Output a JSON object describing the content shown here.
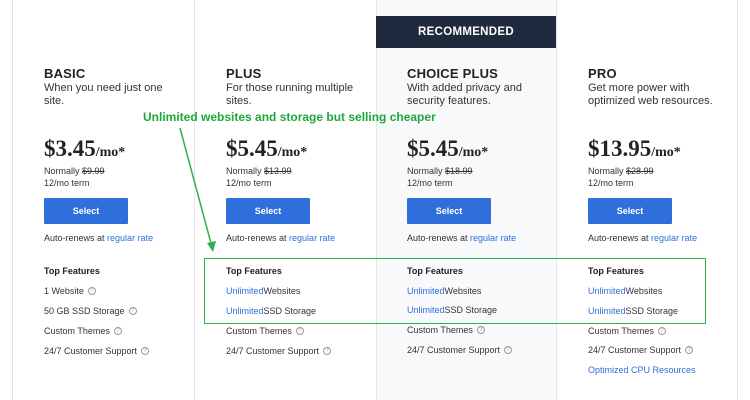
{
  "recommended_label": "RECOMMENDED",
  "annotation": "Unlimited websites and storage but selling cheaper",
  "plans": [
    {
      "name": "BASIC",
      "desc": "When you need just one site.",
      "price": "$3.45",
      "per": "/mo*",
      "normally_label": "Normally",
      "normally_price": "$9.99",
      "term": "12/mo term",
      "select": "Select",
      "autorenew": "Auto-renews at",
      "regular_rate": "regular rate",
      "top_features": "Top Features",
      "features": [
        {
          "pre": "",
          "link": "",
          "rest": "1 Website",
          "info": true
        },
        {
          "pre": "",
          "link": "",
          "rest": "50 GB SSD Storage",
          "info": true
        },
        {
          "pre": "",
          "link": "",
          "rest": "Custom Themes",
          "info": true
        },
        {
          "pre": "",
          "link": "",
          "rest": "24/7 Customer Support",
          "info": true
        }
      ]
    },
    {
      "name": "PLUS",
      "desc": "For those running multiple sites.",
      "price": "$5.45",
      "per": "/mo*",
      "normally_label": "Normally",
      "normally_price": "$13.99",
      "term": "12/mo term",
      "select": "Select",
      "autorenew": "Auto-renews at",
      "regular_rate": "regular rate",
      "top_features": "Top Features",
      "features": [
        {
          "link": "Unlimited",
          "rest": " Websites",
          "info": false
        },
        {
          "link": "Unlimited",
          "rest": " SSD Storage",
          "info": false
        },
        {
          "link": "",
          "rest": "Custom Themes",
          "info": true
        },
        {
          "link": "",
          "rest": "24/7 Customer Support",
          "info": true
        }
      ]
    },
    {
      "name": "CHOICE PLUS",
      "desc": "With added privacy and security features.",
      "price": "$5.45",
      "per": "/mo*",
      "normally_label": "Normally",
      "normally_price": "$18.99",
      "term": "12/mo term",
      "select": "Select",
      "autorenew": "Auto-renews at",
      "regular_rate": "regular rate",
      "top_features": "Top Features",
      "features": [
        {
          "link": "Unlimited",
          "rest": " Websites",
          "info": false
        },
        {
          "link": "Unlimited",
          "rest": " SSD Storage",
          "info": false
        },
        {
          "link": "",
          "rest": "Custom Themes",
          "info": true
        },
        {
          "link": "",
          "rest": "24/7 Customer Support",
          "info": true
        }
      ]
    },
    {
      "name": "PRO",
      "desc": "Get more power with optimized web resources.",
      "price": "$13.95",
      "per": "/mo*",
      "normally_label": "Normally",
      "normally_price": "$28.99",
      "term": "12/mo term",
      "select": "Select",
      "autorenew": "Auto-renews at",
      "regular_rate": "regular rate",
      "top_features": "Top Features",
      "features": [
        {
          "link": "Unlimited",
          "rest": " Websites",
          "info": false
        },
        {
          "link": "Unlimited",
          "rest": " SSD Storage",
          "info": false
        },
        {
          "link": "",
          "rest": "Custom Themes",
          "info": true
        },
        {
          "link": "",
          "rest": "24/7 Customer Support",
          "info": true
        },
        {
          "link": "Optimized CPU Resources",
          "rest": "",
          "info": false
        }
      ]
    }
  ],
  "colors": {
    "accent": "#2f6fdb",
    "banner": "#1f2a3e",
    "annotation": "#1fa83a"
  }
}
